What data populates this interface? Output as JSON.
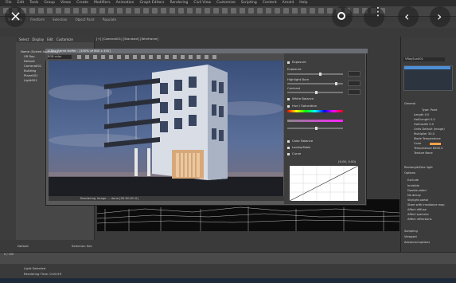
{
  "menu": [
    "File",
    "Edit",
    "Tools",
    "Group",
    "Views",
    "Create",
    "Modifiers",
    "Animation",
    "Graph Editors",
    "Rendering",
    "Civil View",
    "Customize",
    "Scripting",
    "Content",
    "Arnold",
    "Help"
  ],
  "workspace": "Workspaces: Default",
  "ribbon_tabs": [
    "Modeling",
    "Freeform",
    "Selection",
    "Object Paint",
    "Populate"
  ],
  "explorer": {
    "menus": [
      "Select",
      "Display",
      "Edit",
      "Customize"
    ],
    "items": [
      "Name (Sorted Ascending)",
      "VR Ray",
      "Default",
      "Camera001",
      "Building",
      "Plane001",
      "Light001"
    ]
  },
  "viewport_label": "[+] [Camera001] [Standard] [Wireframe]",
  "vfb": {
    "title": "V-Ray frame buffer - [100% of 800 x 450]",
    "channel": "RGB color",
    "status": "Rendering image ... done [00:00:00.0]",
    "panel_items": [
      "Exposure",
      "Exposure",
      "Highlight Burn",
      "Contrast",
      "White Balance",
      "Hue / Saturation",
      "Color Balance",
      "LookupTable",
      "Curve"
    ],
    "curve_coords": "(0.00, 0.00)"
  },
  "cmd": {
    "object_name": "VRaySun001",
    "rollout_general": "General",
    "params": [
      {
        "label": "Type",
        "value": "Point"
      },
      {
        "label": "Length",
        "value": "0.0"
      },
      {
        "label": "Half-length",
        "value": "0.0"
      },
      {
        "label": "Half-width",
        "value": "0.0"
      },
      {
        "label": "Units",
        "value": "Default (image)"
      },
      {
        "label": "Multiplier",
        "value": "30.0"
      },
      {
        "label": "Mode",
        "value": "Temperature"
      },
      {
        "label": "Color",
        "value": ""
      },
      {
        "label": "Temperature",
        "value": "6500.0"
      },
      {
        "label": "Texture",
        "value": "None"
      }
    ],
    "rollout_opts": "Rectangle/Disc light",
    "options_title": "Options",
    "options": [
      "Exclude",
      "Invisible",
      "Double-sided",
      "No decay",
      "Skylight portal",
      "Store with irradiance map",
      "Affect diffuse",
      "Affect specular",
      "Affect reflections"
    ],
    "rollouts_bottom": [
      "Sampling",
      "Viewport",
      "Advanced options"
    ]
  },
  "status": {
    "selection": "Light Selected",
    "prompt": "Rendering Time: 0:00:59",
    "frame": "0 / 100",
    "selection_set": "Selection Set:",
    "default": "Default"
  },
  "colors": {
    "accent": "#4c8fd6",
    "render_sky": "#2a3a6a"
  }
}
